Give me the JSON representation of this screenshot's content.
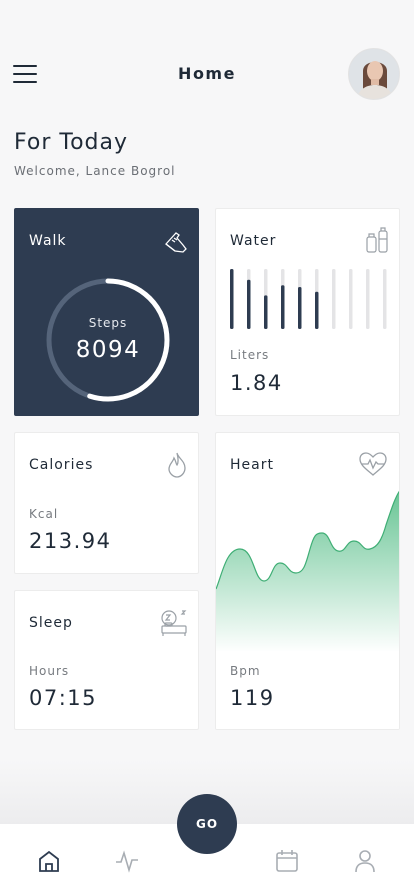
{
  "header": {
    "title": "Home",
    "menu_icon": "hamburger-menu-icon",
    "avatar": "user-avatar"
  },
  "greeting": {
    "title": "For Today",
    "subtitle": "Welcome, Lance Bogrol"
  },
  "cards": {
    "walk": {
      "title": "Walk",
      "icon": "sneaker-icon",
      "unit": "Steps",
      "value": "8094",
      "ring_fraction": 0.55
    },
    "water": {
      "title": "Water",
      "icon": "water-bottle-icon",
      "unit": "Liters",
      "value": "1.84",
      "bars": [
        1.0,
        0.82,
        0.56,
        0.73,
        0.7,
        0.62,
        0,
        0,
        0,
        0
      ],
      "filled_bars": 6
    },
    "calories": {
      "title": "Calories",
      "icon": "flame-icon",
      "unit": "Kcal",
      "value": "213.94"
    },
    "heart": {
      "title": "Heart",
      "icon": "heart-rate-icon",
      "unit": "Bpm",
      "value": "119"
    },
    "sleep": {
      "title": "Sleep",
      "icon": "bed-icon",
      "unit": "Hours",
      "value": "07:15"
    }
  },
  "colors": {
    "dark": "#2e3c51",
    "accent_green": "#5fc18e",
    "bar_empty": "#e4e4e6"
  },
  "tabbar": {
    "go_label": "GO",
    "tabs": [
      "home-icon",
      "activity-icon",
      "calendar-icon",
      "profile-icon"
    ]
  }
}
